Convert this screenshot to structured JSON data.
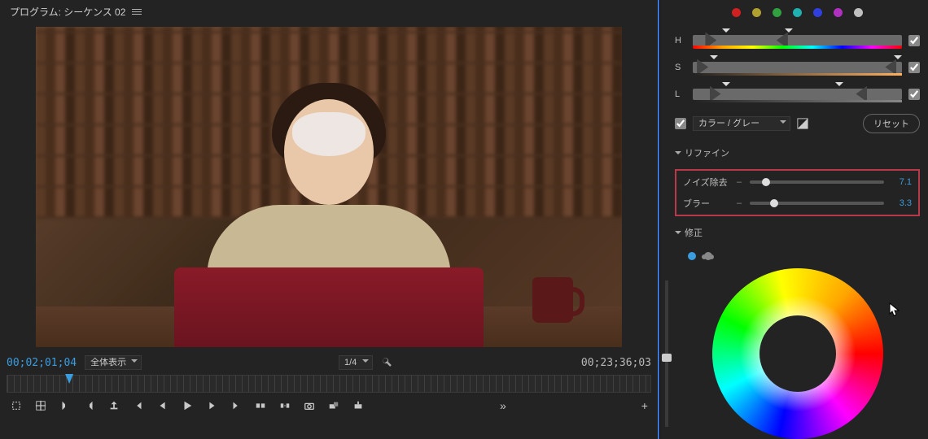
{
  "program_panel": {
    "title": "プログラム: シーケンス 02",
    "current_tc": "00;02;01;04",
    "zoom_mode": "全体表示",
    "scale": "1/4",
    "total_tc": "00;23;36;03"
  },
  "hsl": {
    "swatches": [
      "#d02020",
      "#b0a030",
      "#30a040",
      "#20b0b0",
      "#3040e0",
      "#b030c0",
      "#c0c0c0"
    ],
    "h_label": "H",
    "s_label": "S",
    "l_label": "L"
  },
  "key_row": {
    "checked": true,
    "select_label": "カラー / グレー",
    "reset_label": "リセット"
  },
  "refine": {
    "title": "リファイン",
    "denoise_label": "ノイズ除去",
    "denoise_value": "7.1",
    "denoise_pct": 12,
    "blur_label": "ブラー",
    "blur_value": "3.3",
    "blur_pct": 18
  },
  "correction": {
    "title": "修正"
  },
  "transport_icons": [
    "marker-add-icon",
    "grid-icon",
    "in-mark-icon",
    "out-mark-icon",
    "export-icon",
    "go-in-icon",
    "step-back-icon",
    "play-icon",
    "step-fwd-icon",
    "go-out-icon",
    "lift-icon",
    "extract-icon",
    "camera-icon",
    "insert-icon",
    "overwrite-icon"
  ]
}
